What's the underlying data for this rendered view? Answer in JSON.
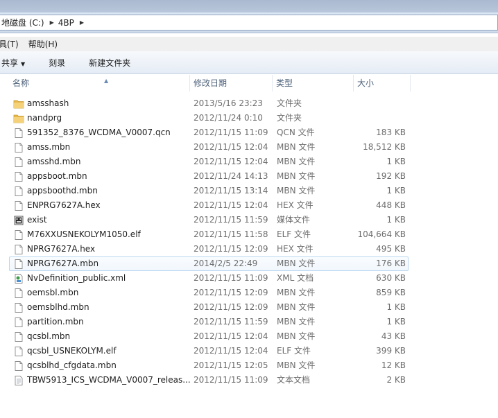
{
  "address": {
    "drive_label": "地磁盘 (C:)",
    "folder_label": "4BP"
  },
  "menu": [
    {
      "label": "具(T)"
    },
    {
      "label": "帮助(H)"
    }
  ],
  "toolbar": {
    "share_label": "共享",
    "burn_label": "刻录",
    "new_folder_label": "新建文件夹"
  },
  "columns": {
    "name": "名称",
    "date": "修改日期",
    "type": "类型",
    "size": "大小"
  },
  "files": [
    {
      "name": "amsshash",
      "date": "2013/5/16 23:23",
      "type": "文件夹",
      "size": "",
      "icon": "folder-icon"
    },
    {
      "name": "nandprg",
      "date": "2012/11/24 0:10",
      "type": "文件夹",
      "size": "",
      "icon": "folder-icon"
    },
    {
      "name": "591352_8376_WCDMA_V0007.qcn",
      "date": "2012/11/15 11:09",
      "type": "QCN 文件",
      "size": "183 KB",
      "icon": "file-icon"
    },
    {
      "name": "amss.mbn",
      "date": "2012/11/15 12:04",
      "type": "MBN 文件",
      "size": "18,512 KB",
      "icon": "file-icon"
    },
    {
      "name": "amsshd.mbn",
      "date": "2012/11/15 12:04",
      "type": "MBN 文件",
      "size": "1 KB",
      "icon": "file-icon"
    },
    {
      "name": "appsboot.mbn",
      "date": "2012/11/24 14:13",
      "type": "MBN 文件",
      "size": "192 KB",
      "icon": "file-icon"
    },
    {
      "name": "appsboothd.mbn",
      "date": "2012/11/15 13:14",
      "type": "MBN 文件",
      "size": "1 KB",
      "icon": "file-icon"
    },
    {
      "name": "ENPRG7627A.hex",
      "date": "2012/11/15 12:04",
      "type": "HEX 文件",
      "size": "448 KB",
      "icon": "file-icon"
    },
    {
      "name": "exist",
      "date": "2012/11/15 11:59",
      "type": "媒体文件",
      "size": "1 KB",
      "icon": "media-file-icon"
    },
    {
      "name": "M76XXUSNEKOLYM1050.elf",
      "date": "2012/11/15 11:58",
      "type": "ELF 文件",
      "size": "104,664 KB",
      "icon": "file-icon"
    },
    {
      "name": "NPRG7627A.hex",
      "date": "2012/11/15 12:09",
      "type": "HEX 文件",
      "size": "495 KB",
      "icon": "file-icon"
    },
    {
      "name": "NPRG7627A.mbn",
      "date": "2014/2/5 22:49",
      "type": "MBN 文件",
      "size": "176 KB",
      "icon": "file-icon"
    },
    {
      "name": "NvDefinition_public.xml",
      "date": "2012/11/15 11:09",
      "type": "XML 文档",
      "size": "630 KB",
      "icon": "xml-file-icon"
    },
    {
      "name": "oemsbl.mbn",
      "date": "2012/11/15 12:09",
      "type": "MBN 文件",
      "size": "859 KB",
      "icon": "file-icon"
    },
    {
      "name": "oemsblhd.mbn",
      "date": "2012/11/15 12:09",
      "type": "MBN 文件",
      "size": "1 KB",
      "icon": "file-icon"
    },
    {
      "name": "partition.mbn",
      "date": "2012/11/15 11:59",
      "type": "MBN 文件",
      "size": "1 KB",
      "icon": "file-icon"
    },
    {
      "name": "qcsbl.mbn",
      "date": "2012/11/15 12:04",
      "type": "MBN 文件",
      "size": "43 KB",
      "icon": "file-icon"
    },
    {
      "name": "qcsbl_USNEKOLYM.elf",
      "date": "2012/11/15 12:04",
      "type": "ELF 文件",
      "size": "399 KB",
      "icon": "file-icon"
    },
    {
      "name": "qcsblhd_cfgdata.mbn",
      "date": "2012/11/15 12:05",
      "type": "MBN 文件",
      "size": "12 KB",
      "icon": "file-icon"
    },
    {
      "name": "TBW5913_ICS_WCDMA_V0007_releas...",
      "date": "2012/11/15 11:09",
      "type": "文本文档",
      "size": "2 KB",
      "icon": "text-file-icon"
    }
  ],
  "hovered_file": "NPRG7627A.mbn"
}
